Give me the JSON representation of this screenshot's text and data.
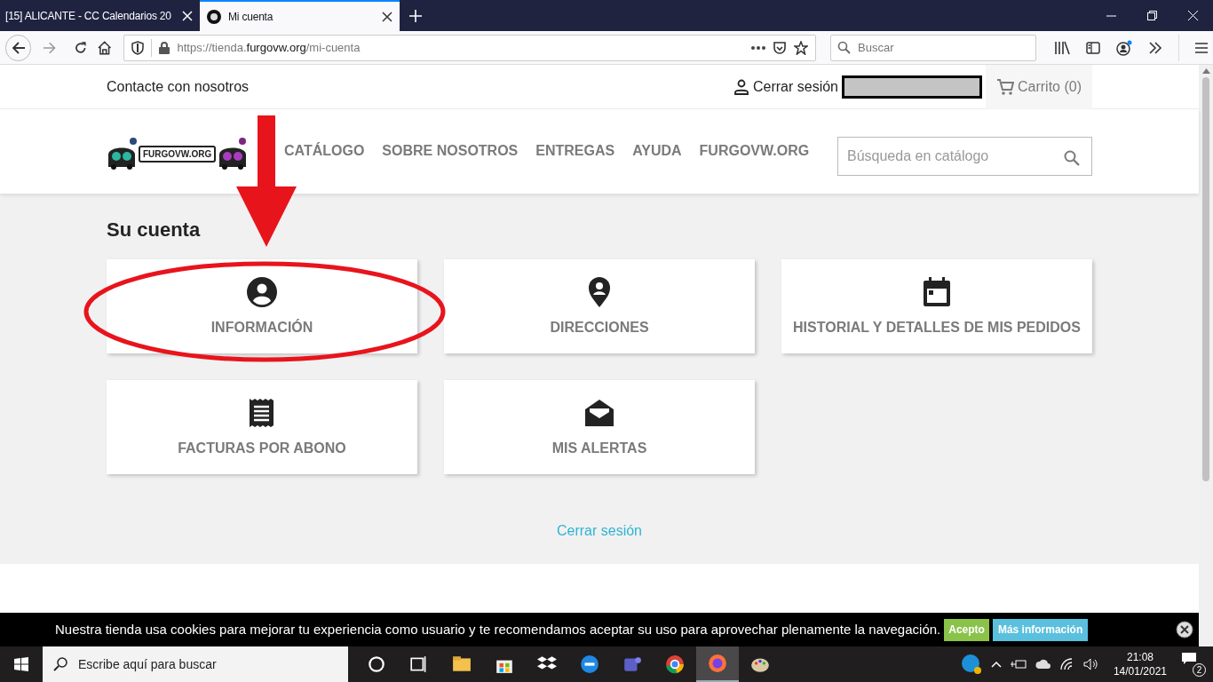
{
  "browser": {
    "tabs": [
      {
        "title": "[15] ALICANTE - CC Calendarios 20",
        "selected": false
      },
      {
        "title": "Mi cuenta",
        "selected": true
      }
    ],
    "url": {
      "prefix": "https://tienda.",
      "domain": "furgovw.org",
      "path": "/mi-cuenta"
    },
    "search": {
      "placeholder": "Buscar"
    }
  },
  "header": {
    "contact": "Contacte con nosotros",
    "logout": "Cerrar sesión",
    "cart": "Carrito (0)",
    "logo_text": "FURGOVW.ORG",
    "nav": [
      "CATÁLOGO",
      "SOBRE NOSOTROS",
      "ENTREGAS",
      "AYUDA",
      "FURGOVW.ORG"
    ],
    "search": {
      "placeholder": "Búsqueda en catálogo"
    }
  },
  "account": {
    "title": "Su cuenta",
    "cards": [
      {
        "kind": "person",
        "label": "INFORMACIÓN"
      },
      {
        "kind": "pin",
        "label": "DIRECCIONES"
      },
      {
        "kind": "calendar",
        "label": "HISTORIAL Y DETALLES DE MIS PEDIDOS"
      },
      {
        "kind": "receipt",
        "label": "FACTURAS POR ABONO"
      },
      {
        "kind": "mail",
        "label": "MIS ALERTAS"
      }
    ],
    "logout_link": "Cerrar sesión"
  },
  "cookie_bar": {
    "text": "Nuestra tienda usa cookies para mejorar tu experiencia como usuario y te recomendamos aceptar su uso para aprovechar plenamente la navegación.",
    "accept": "Acepto",
    "more": "Más información"
  },
  "taskbar": {
    "search": "Escribe aquí para buscar",
    "time": "21:08",
    "date": "14/01/2021",
    "notifications": "2"
  }
}
